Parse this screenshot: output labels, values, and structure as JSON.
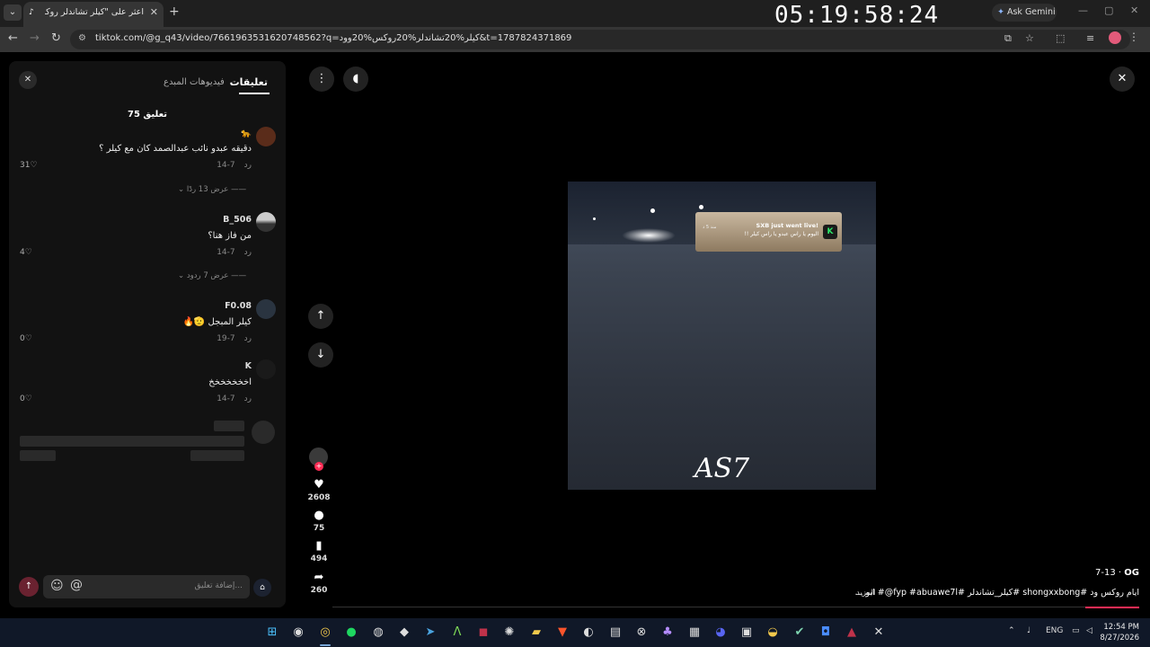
{
  "browser": {
    "tab_title": "اعثر على \"كيلر تشاندلر روكس",
    "timer": "05:19:58:24",
    "gemini_label": "Ask Gemini",
    "url": "tiktok.com/@g_q43/video/7661963531620748562?q=كيلر%20تشاندلر%20روكس%20وود&t=1787824371869"
  },
  "panel": {
    "tab_comments": "تعليقات",
    "tab_creator_videos": "فيديوهات المبدع",
    "comment_count": "75 تعليق",
    "comments": [
      {
        "name": "🐆",
        "text": "دقيقه عبدو نائب عبدالصمد كان مع كيلر ؟",
        "date": "7-14",
        "reply": "رد",
        "likes": "31",
        "replies": "عرض 13 ردًا"
      },
      {
        "name": "B_506",
        "text": "من فاز هنا؟",
        "date": "7-14",
        "reply": "رد",
        "likes": "4",
        "replies": "عرض 7 ردود"
      },
      {
        "name": "F0.08",
        "text": "كيلر المبجل 🫡🔥",
        "date": "7-19",
        "reply": "رد",
        "likes": "0"
      },
      {
        "name": "K",
        "text": "اخخخخخخخ",
        "date": "7-14",
        "reply": "رد",
        "likes": "0"
      }
    ],
    "comment_placeholder": "إضافة تعليق..."
  },
  "video": {
    "notif_title": "SXB just went live!",
    "notif_body": "اليوم يا راس عبدو يا راس كيلر !!",
    "notif_time": "منذ 5 د",
    "notif_badge": "K",
    "watermark": "AS7",
    "likes": "2608",
    "comments": "75",
    "saves": "494",
    "shares": "260",
    "author": "OG",
    "author_date": "7-13",
    "description": "ايام روكس ود #shongxxbong #كيلر_تشاندلر #fyp #abuawe7l@# ابو ...",
    "more": "المزيد"
  },
  "taskbar": {
    "lang": "ENG",
    "time": "12:54 PM",
    "date": "8/27/2026"
  },
  "colors": {
    "accent": "#fe2c55",
    "panel_bg": "#121212"
  }
}
